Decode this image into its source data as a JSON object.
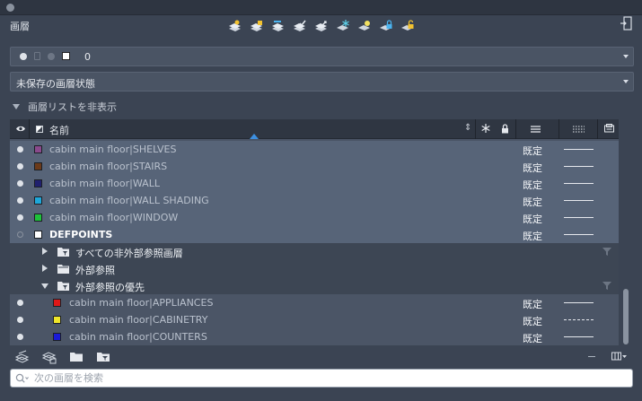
{
  "window": {
    "title": "画層"
  },
  "toolbar": {
    "icons": [
      "new-layer-icon",
      "new-layer-vp-frozen-icon",
      "delete-layer-icon",
      "set-current-icon",
      "layer-match-icon",
      "freeze-icon",
      "isolate-icon",
      "lock-icon",
      "unlock-icon"
    ]
  },
  "current_layer": {
    "name": "0"
  },
  "layer_state": {
    "value": "未保存の画層状態"
  },
  "layer_list_toggle": {
    "label": "画層リストを非表示"
  },
  "table": {
    "columns": {
      "name": "名前",
      "sort_symbol": "⇕"
    },
    "rows": [
      {
        "name": "cabin main floor|SHELVES",
        "color": "#8a4a8c",
        "on": true,
        "lineweight": "既定",
        "linetype": "solid",
        "highlighted": true
      },
      {
        "name": "cabin main floor|STAIRS",
        "color": "#6b3a1a",
        "on": true,
        "lineweight": "既定",
        "linetype": "solid",
        "highlighted": true
      },
      {
        "name": "cabin main floor|WALL",
        "color": "#20206e",
        "on": true,
        "lineweight": "既定",
        "linetype": "solid",
        "highlighted": true
      },
      {
        "name": "cabin main floor|WALL SHADING",
        "color": "#1ea7d9",
        "on": true,
        "lineweight": "既定",
        "linetype": "solid",
        "highlighted": true
      },
      {
        "name": "cabin main floor|WINDOW",
        "color": "#1ec23a",
        "on": true,
        "lineweight": "既定",
        "linetype": "solid",
        "highlighted": true
      },
      {
        "name": "DEFPOINTS",
        "color": "#ffffff",
        "on": false,
        "lineweight": "既定",
        "linetype": "solid",
        "highlighted": true
      }
    ],
    "groups": [
      {
        "label": "すべての非外部参照画層",
        "expanded": false
      },
      {
        "label": "外部参照",
        "expanded": false
      },
      {
        "label": "外部参照の優先",
        "expanded": true
      }
    ],
    "sub_rows": [
      {
        "name": "cabin main floor|APPLIANCES",
        "color": "#e01818",
        "on": true,
        "lineweight": "既定",
        "linetype": "solid"
      },
      {
        "name": "cabin main floor|CABINETRY",
        "color": "#f0e62a",
        "on": true,
        "lineweight": "既定",
        "linetype": "dashed"
      },
      {
        "name": "cabin main floor|COUNTERS",
        "color": "#1a1ad8",
        "on": true,
        "lineweight": "既定",
        "linetype": "solid"
      }
    ]
  },
  "search": {
    "placeholder": "次の画層を検索"
  }
}
